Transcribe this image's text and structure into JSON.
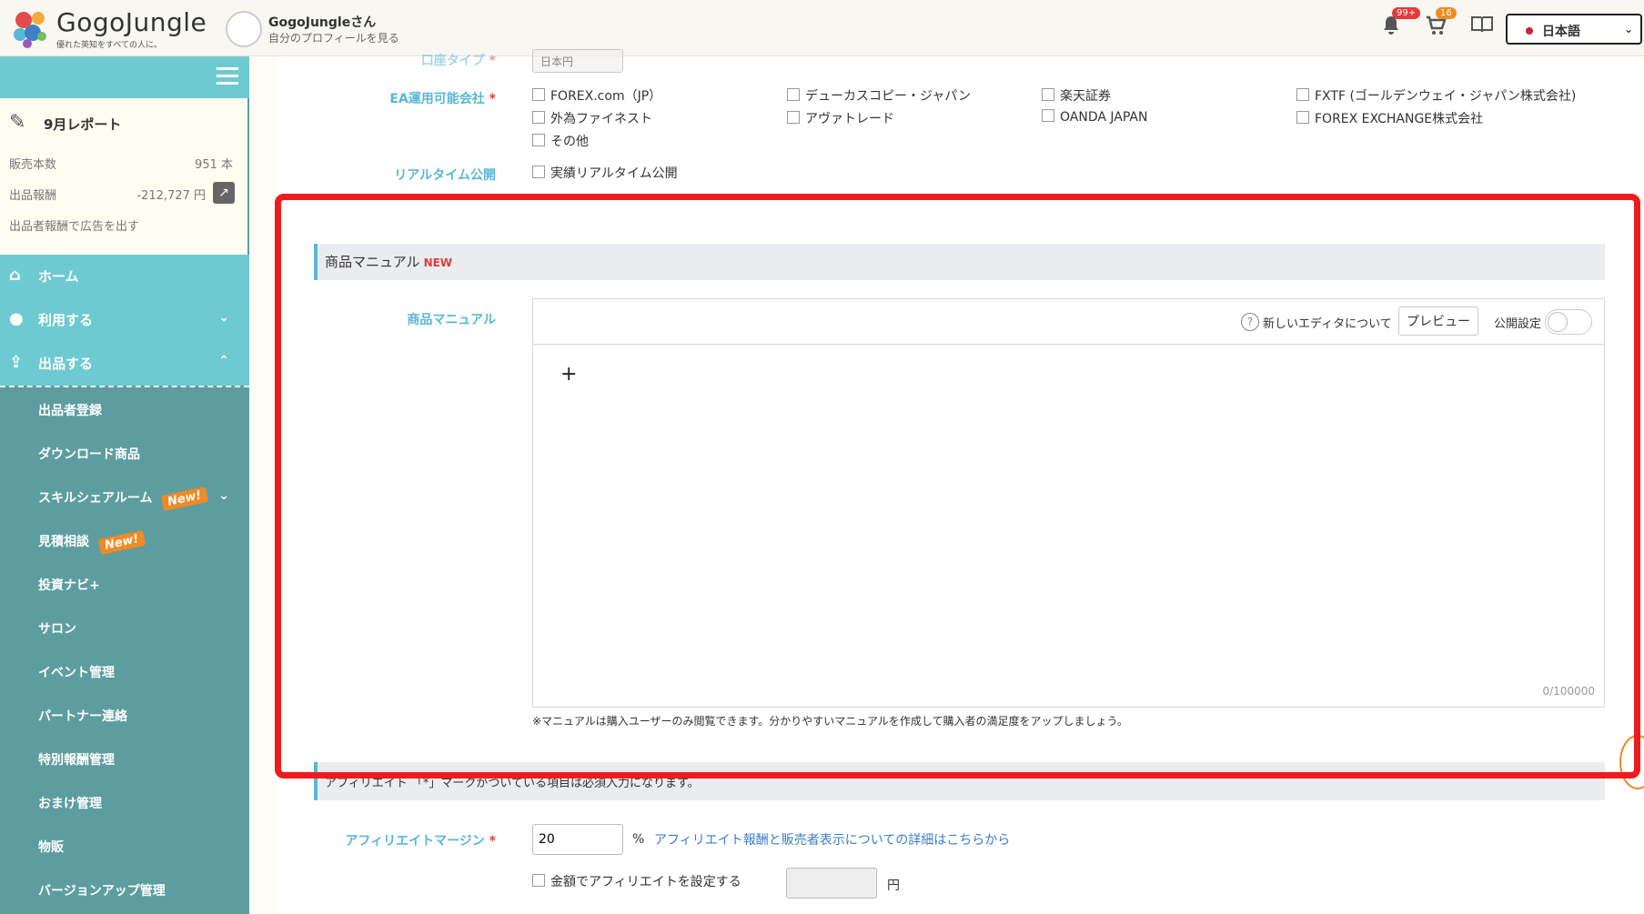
{
  "header": {
    "logo_text": "GogoJungle",
    "logo_tagline": "優れた英知をすべての人に。",
    "profile_name": "GogoJungleさん",
    "profile_sub": "自分のプロフィールを見る",
    "notif_badge": "99+",
    "cart_badge": "16",
    "language": "日本語",
    "colors": {
      "notif_badge": "#e53b3b",
      "cart_badge": "#f08a24"
    }
  },
  "sidebar": {
    "report": {
      "title": "9月レポート",
      "sales_label": "販売本数",
      "sales_value": "951 本",
      "reward_label": "出品報酬",
      "reward_value": "-212,727 円",
      "ad_link": "出品者報酬で広告を出す"
    },
    "nav": {
      "home": "ホーム",
      "use": "利用する",
      "sell": "出品する"
    },
    "sub_items": [
      {
        "label": "出品者登録"
      },
      {
        "label": "ダウンロード商品"
      },
      {
        "label": "スキルシェアルーム",
        "badge": "New!"
      },
      {
        "label": "見積相談",
        "badge": "New!"
      },
      {
        "label": "投資ナビ+"
      },
      {
        "label": "サロン"
      },
      {
        "label": "イベント管理"
      },
      {
        "label": "パートナー連絡"
      },
      {
        "label": "特別報酬管理"
      },
      {
        "label": "おまけ管理"
      },
      {
        "label": "物販"
      },
      {
        "label": "バージョンアップ管理"
      }
    ]
  },
  "form": {
    "currency_label": "口座タイプ",
    "currency_value": "日本円",
    "ea_label": "EA運用可能会社",
    "ea_options": [
      "FOREX.com（JP）",
      "デューカスコピー・ジャパン",
      "楽天証券",
      "FXTF (ゴールデンウェイ・ジャパン株式会社)",
      "外為ファイネスト",
      "アヴァトレード",
      "OANDA JAPAN",
      "FOREX EXCHANGE株式会社",
      "その他"
    ],
    "realtime_label": "リアルタイム公開",
    "realtime_option": "実績リアルタイム公開",
    "manual_section_title": "商品マニュアル",
    "manual_section_badge": "NEW",
    "manual_label": "商品マニュアル",
    "editor_help": "新しいエディタについて",
    "editor_preview": "プレビュー",
    "editor_public": "公開設定",
    "editor_plus": "+",
    "editor_counter": "0/100000",
    "manual_note": "※マニュアルは購入ユーザーのみ閲覧できます。分かりやすいマニュアルを作成して購入者の満足度をアップしましょう。",
    "affiliate_section_text": "アフィリエイト 「*」マークがついている項目は必須入力になります。",
    "affiliate_margin_label": "アフィリエイトマージン",
    "affiliate_margin_value": "20",
    "affiliate_margin_unit": "%",
    "affiliate_link": "アフィリエイト報酬と販売者表示についての詳細はこちらから",
    "affiliate_amount_option": "金額でアフィリエイトを設定する",
    "affiliate_amount_unit": "円",
    "required_mark": "*"
  }
}
